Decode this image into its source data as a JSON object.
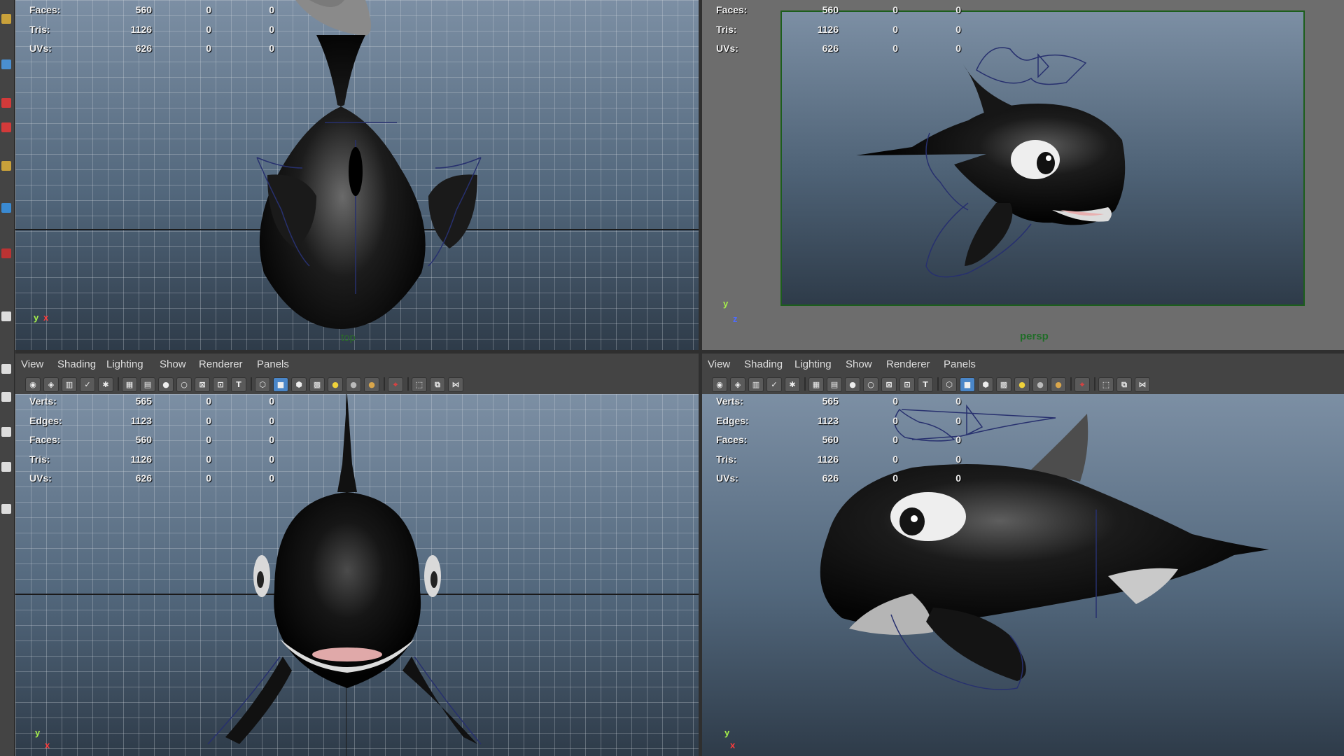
{
  "colors": {
    "viewport_top": "#7c8fa4",
    "viewport_bottom": "#2e3b49",
    "camera_frame": "#1c5e1c",
    "hud_text": "#f1f1f1",
    "axis_y": "#a6f04a",
    "axis_x": "#ff3b3b",
    "axis_z": "#4d6bff"
  },
  "panel_menu": [
    "View",
    "Shading",
    "Lighting",
    "Show",
    "Renderer",
    "Panels"
  ],
  "toolbar_icons": [
    "select-camera-icon",
    "lock-camera-icon",
    "bookmarks-icon",
    "image-plane-icon",
    "2d-pan-zoom-icon",
    "grid-icon",
    "film-gate-icon",
    "resolution-gate-icon",
    "gate-mask-icon",
    "field-chart-icon",
    "safe-action-icon",
    "safe-title-icon",
    "wireframe-icon",
    "smooth-shade-icon",
    "wireframe-on-shaded-icon",
    "textured-icon",
    "use-all-lights-icon",
    "shadows-icon",
    "ambient-occlusion-icon",
    "isolate-select-icon",
    "xray-icon",
    "xray-joints-icon",
    "xray-components-icon"
  ],
  "panels": {
    "top_left": {
      "hud": [
        {
          "label": "Faces:",
          "v1": "560",
          "v2": "0",
          "v3": "0"
        },
        {
          "label": "Tris:",
          "v1": "1126",
          "v2": "0",
          "v3": "0"
        },
        {
          "label": "UVs:",
          "v1": "626",
          "v2": "0",
          "v3": "0"
        }
      ],
      "axis": {
        "y": "y",
        "x": "x"
      },
      "camera_label": "top"
    },
    "top_right": {
      "hud": [
        {
          "label": "Faces:",
          "v1": "560",
          "v2": "0",
          "v3": "0"
        },
        {
          "label": "Tris:",
          "v1": "1126",
          "v2": "0",
          "v3": "0"
        },
        {
          "label": "UVs:",
          "v1": "626",
          "v2": "0",
          "v3": "0"
        }
      ],
      "axis": {
        "y": "y",
        "z": "z"
      },
      "camera_label": "persp"
    },
    "bottom_left": {
      "hud": [
        {
          "label": "Verts:",
          "v1": "565",
          "v2": "0",
          "v3": "0"
        },
        {
          "label": "Edges:",
          "v1": "1123",
          "v2": "0",
          "v3": "0"
        },
        {
          "label": "Faces:",
          "v1": "560",
          "v2": "0",
          "v3": "0"
        },
        {
          "label": "Tris:",
          "v1": "1126",
          "v2": "0",
          "v3": "0"
        },
        {
          "label": "UVs:",
          "v1": "626",
          "v2": "0",
          "v3": "0"
        }
      ],
      "axis": {
        "y": "y",
        "x": "x"
      }
    },
    "bottom_right": {
      "hud": [
        {
          "label": "Verts:",
          "v1": "565",
          "v2": "0",
          "v3": "0"
        },
        {
          "label": "Edges:",
          "v1": "1123",
          "v2": "0",
          "v3": "0"
        },
        {
          "label": "Faces:",
          "v1": "560",
          "v2": "0",
          "v3": "0"
        },
        {
          "label": "Tris:",
          "v1": "1126",
          "v2": "0",
          "v3": "0"
        },
        {
          "label": "UVs:",
          "v1": "626",
          "v2": "0",
          "v3": "0"
        }
      ],
      "axis": {
        "y": "y",
        "x": "x"
      }
    }
  }
}
